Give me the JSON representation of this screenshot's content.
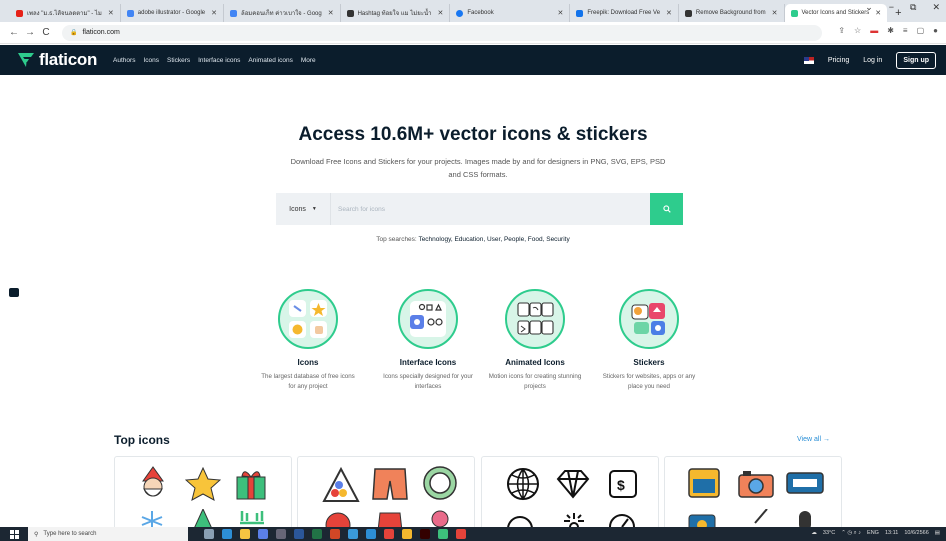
{
  "browser": {
    "tabs": [
      {
        "label": "เพลง \"ม.ธ.ไส้จนลดตาม\" - ไม",
        "color": "#e62117"
      },
      {
        "label": "adobe illustrator - Google",
        "color": "#4285f4"
      },
      {
        "label": "ล้อมคอนเก็ท ค่าวเบาใจ - Goog",
        "color": "#4285f4"
      },
      {
        "label": "Hashtag ท้อยใจ แม ไม่ยะน้ำ",
        "color": "#333333"
      },
      {
        "label": "Facebook",
        "color": "#1877f2"
      },
      {
        "label": "Freepik: Download Free Ve",
        "color": "#1273eb"
      },
      {
        "label": "Remove Background from",
        "color": "#333333"
      },
      {
        "label": "Vector Icons and Stickers",
        "color": "#2ecc8d"
      }
    ],
    "new_tab": "+",
    "url": "flaticon.com",
    "window_controls": [
      "⌄",
      "−",
      "⧉",
      "✕"
    ]
  },
  "site": {
    "logo": "flaticon",
    "nav": [
      "Authors",
      "Icons",
      "Stickers",
      "Interface icons",
      "Animated icons",
      "More"
    ],
    "pricing": "Pricing",
    "login": "Log in",
    "signup": "Sign up"
  },
  "hero": {
    "title": "Access 10.6M+ vector icons & stickers",
    "subtitle": "Download Free Icons and Stickers for your projects. Images made by and for designers in PNG, SVG, EPS, PSD and CSS formats.",
    "select_value": "Icons",
    "search_placeholder": "Search for icons",
    "top_searches_label": "Top searches:",
    "top_searches": "Technology, Education, User, People, Food, Security"
  },
  "categories": [
    {
      "title": "Icons",
      "desc": "The largest database of free icons for any project"
    },
    {
      "title": "Interface Icons",
      "desc": "Icons specially designed for your interfaces"
    },
    {
      "title": "Animated Icons",
      "desc": "Motion icons for creating stunning projects"
    },
    {
      "title": "Stickers",
      "desc": "Stickers for websites, apps or any place you need"
    }
  ],
  "top_icons": {
    "title": "Top icons",
    "view_all": "View all →"
  },
  "taskbar": {
    "search_placeholder": "Type here to search",
    "weather": "33°C",
    "lang": "ENG",
    "time": "13:11",
    "date": "10/6/2566"
  },
  "colors": {
    "brand_dark": "#0b1d2c",
    "brand_green": "#2ecc8d",
    "link_blue": "#2a8fd6"
  }
}
